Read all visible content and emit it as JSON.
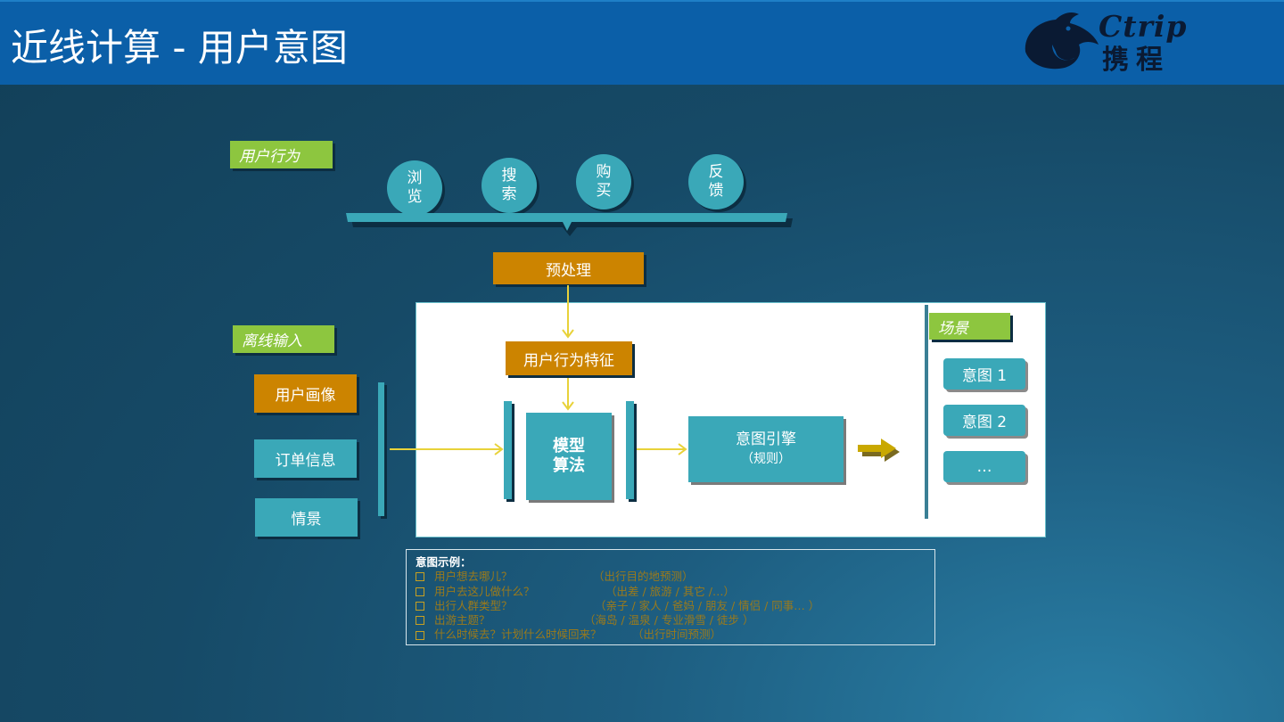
{
  "header": {
    "title": "近线计算 - 用户意图",
    "logo": {
      "latin": "Ctrip",
      "chinese": "携程"
    }
  },
  "user_behavior": {
    "label": "用户行为",
    "actions": [
      {
        "lines": [
          "浏",
          "览"
        ]
      },
      {
        "lines": [
          "搜",
          "索"
        ]
      },
      {
        "lines": [
          "购",
          "买"
        ]
      },
      {
        "lines": [
          "反",
          "馈"
        ]
      }
    ]
  },
  "preprocess": "预处理",
  "feature": "用户行为特征",
  "offline": {
    "label": "离线输入",
    "items": [
      "用户画像",
      "订单信息",
      "情景"
    ]
  },
  "model": {
    "line1": "模型",
    "line2": "算法"
  },
  "engine": {
    "line1": "意图引擎",
    "line2": "（规则）"
  },
  "scenes": {
    "label": "场景",
    "intents": [
      "意图 1",
      "意图 2",
      "…"
    ]
  },
  "examples": {
    "heading": "意图示例：",
    "items": [
      {
        "question": "用户想去哪儿？",
        "answer": "（出行目的地预测）"
      },
      {
        "question": "用户去这儿做什么？",
        "answer": "（出差 / 旅游 / 其它 /…）"
      },
      {
        "question": "出行人群类型？",
        "answer": "（亲子 / 家人 / 爸妈 / 朋友 / 情侣 / 同事… ）"
      },
      {
        "question": "出游主题？",
        "answer": "（海岛 / 温泉 / 专业滑雪 / 徒步 ）"
      },
      {
        "question": "什么时候去？计划什么时候回来？",
        "answer": "（出行时间预测）"
      }
    ]
  },
  "colors": {
    "header": "#0b5fa8",
    "teal": "#3aa8b8",
    "orange": "#cc8400",
    "green": "#8dc63f",
    "arrow": "#e8d23a",
    "big_arrow": "#c9a800",
    "example_text": "#9a7a1c"
  }
}
